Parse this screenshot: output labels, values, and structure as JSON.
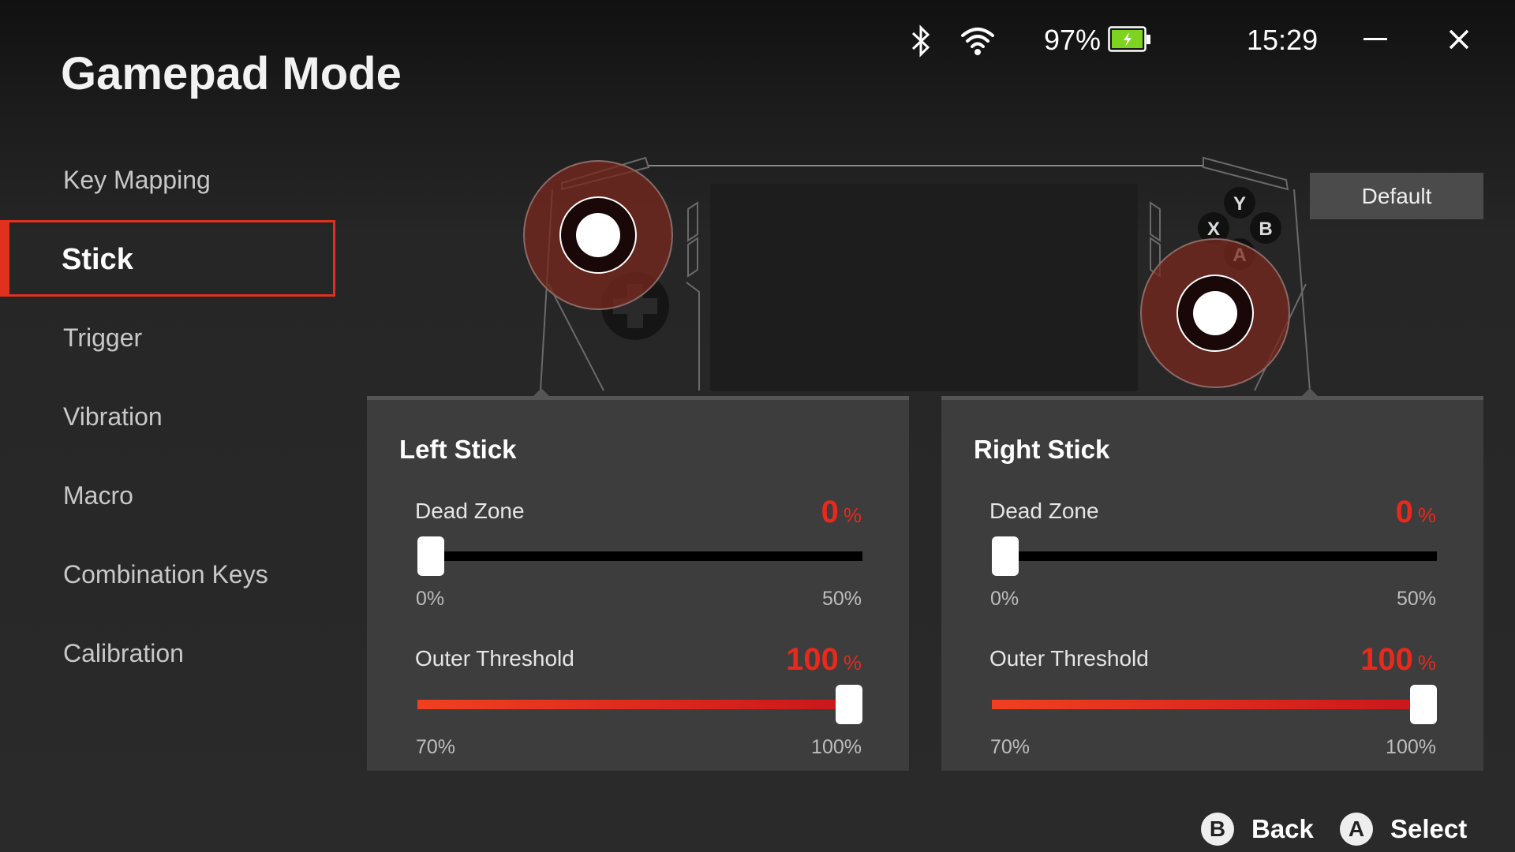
{
  "header": {
    "title": "Gamepad Mode"
  },
  "status": {
    "battery": "97%",
    "battery_color": "#7ed321",
    "time": "15:29"
  },
  "sidebar": {
    "items": [
      {
        "label": "Key Mapping"
      },
      {
        "label": "Stick",
        "selected": true
      },
      {
        "label": "Trigger"
      },
      {
        "label": "Vibration"
      },
      {
        "label": "Macro"
      },
      {
        "label": "Combination Keys"
      },
      {
        "label": "Calibration"
      }
    ]
  },
  "default_label": "Default",
  "device": {
    "buttons": [
      "Y",
      "X",
      "B",
      "A"
    ]
  },
  "panels": [
    {
      "title": "Left Stick",
      "dead_zone": {
        "label": "Dead Zone",
        "value": "0",
        "unit": "%",
        "min": "0%",
        "max": "50%",
        "fraction": 0
      },
      "outer": {
        "label": "Outer Threshold",
        "value": "100",
        "unit": "%",
        "min": "70%",
        "max": "100%",
        "fraction": 1
      }
    },
    {
      "title": "Right Stick",
      "dead_zone": {
        "label": "Dead Zone",
        "value": "0",
        "unit": "%",
        "min": "0%",
        "max": "50%",
        "fraction": 0
      },
      "outer": {
        "label": "Outer Threshold",
        "value": "100",
        "unit": "%",
        "min": "70%",
        "max": "100%",
        "fraction": 1
      }
    }
  ],
  "footer": {
    "back_key": "B",
    "back": "Back",
    "select_key": "A",
    "select": "Select"
  },
  "accent": "#e0301e"
}
